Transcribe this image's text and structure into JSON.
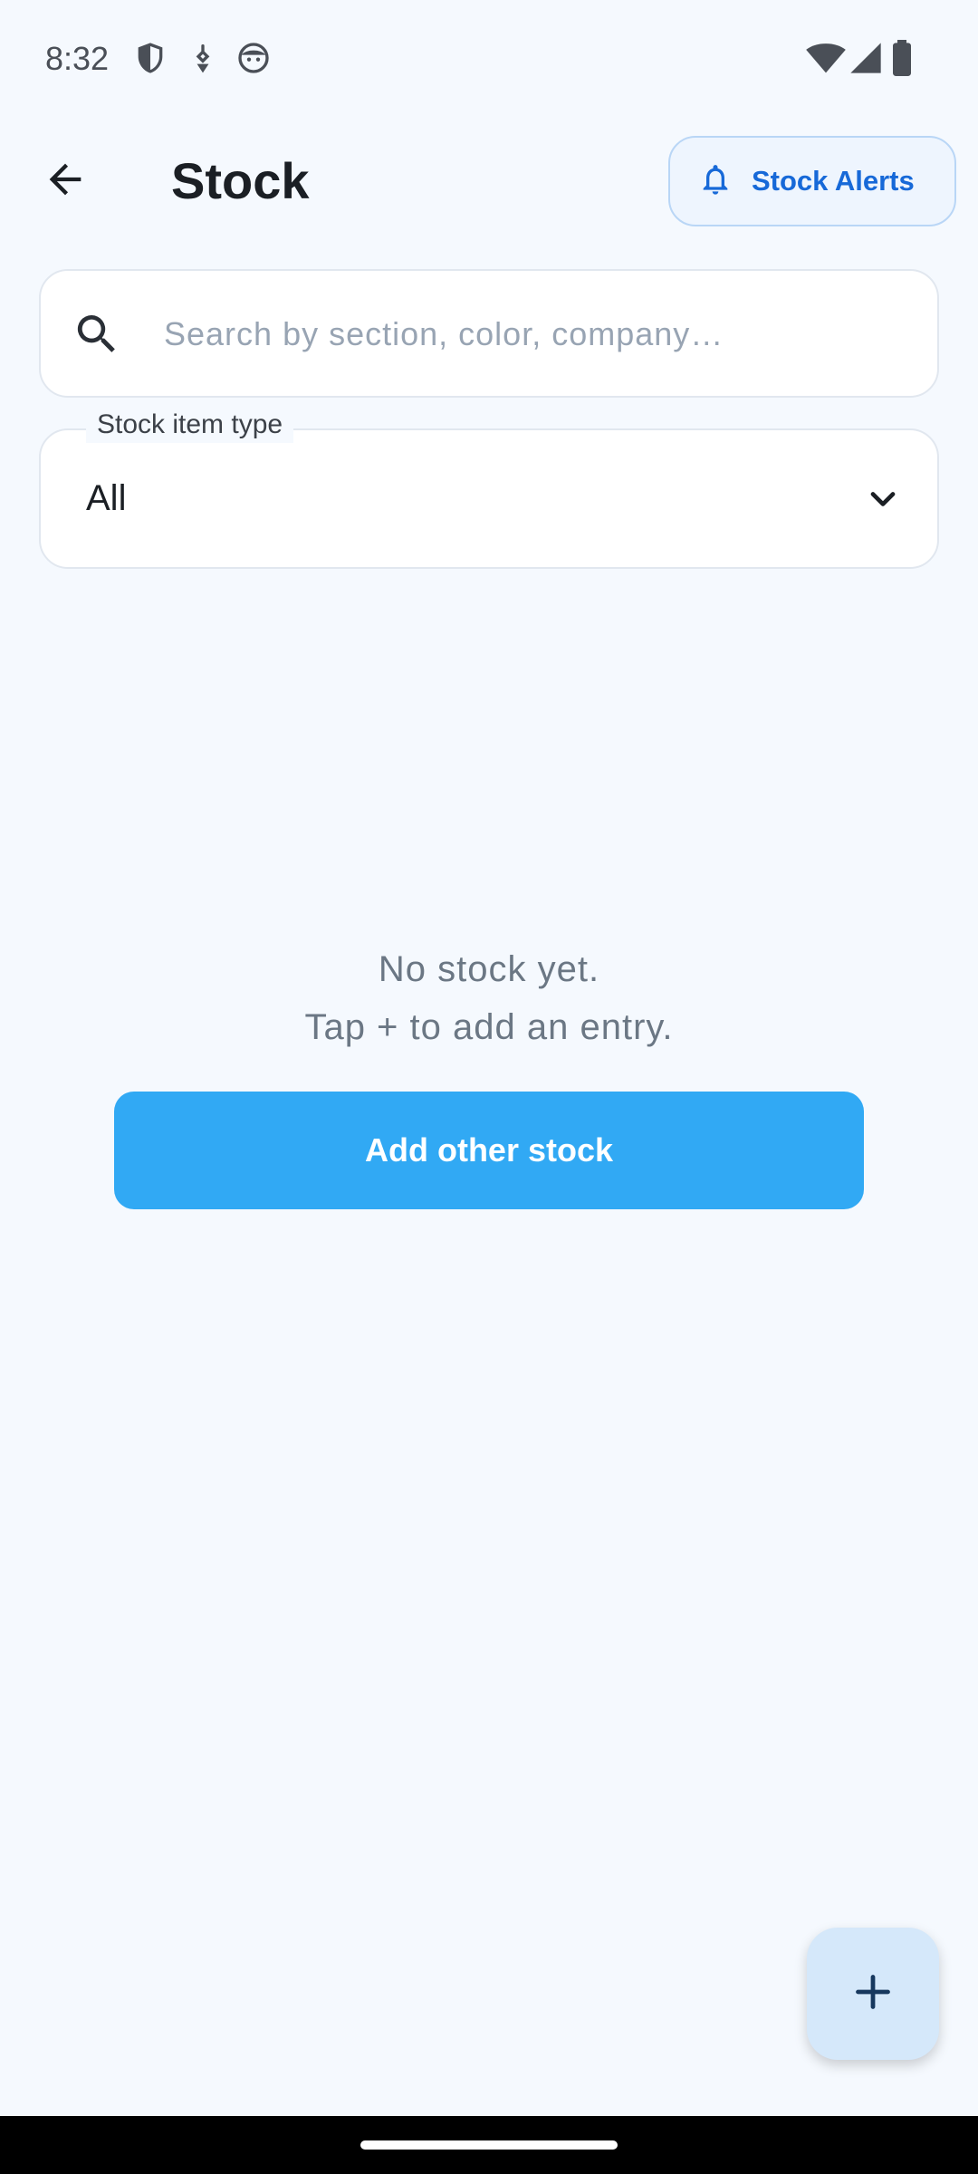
{
  "status_bar": {
    "time": "8:32",
    "icons_left": [
      "shield-icon",
      "vpn-key-icon",
      "face-icon"
    ],
    "icons_right": [
      "wifi-icon",
      "cell-signal-icon",
      "battery-icon"
    ]
  },
  "header": {
    "title": "Stock",
    "back_icon": "arrow-back-icon",
    "alerts_button_label": "Stock Alerts",
    "alerts_icon": "bell-icon"
  },
  "search": {
    "placeholder": "Search by section, color, company…",
    "value": ""
  },
  "filter": {
    "label": "Stock item type",
    "selected": "All"
  },
  "empty_state": {
    "line1": "No stock yet.",
    "line2": "Tap + to add an entry.",
    "button_label": "Add other stock"
  },
  "fab": {
    "icon": "plus-icon"
  },
  "colors": {
    "background": "#F5F9FE",
    "accent": "#1769D8",
    "primary_button": "#31A9F4",
    "fab": "#D5E8FA"
  }
}
